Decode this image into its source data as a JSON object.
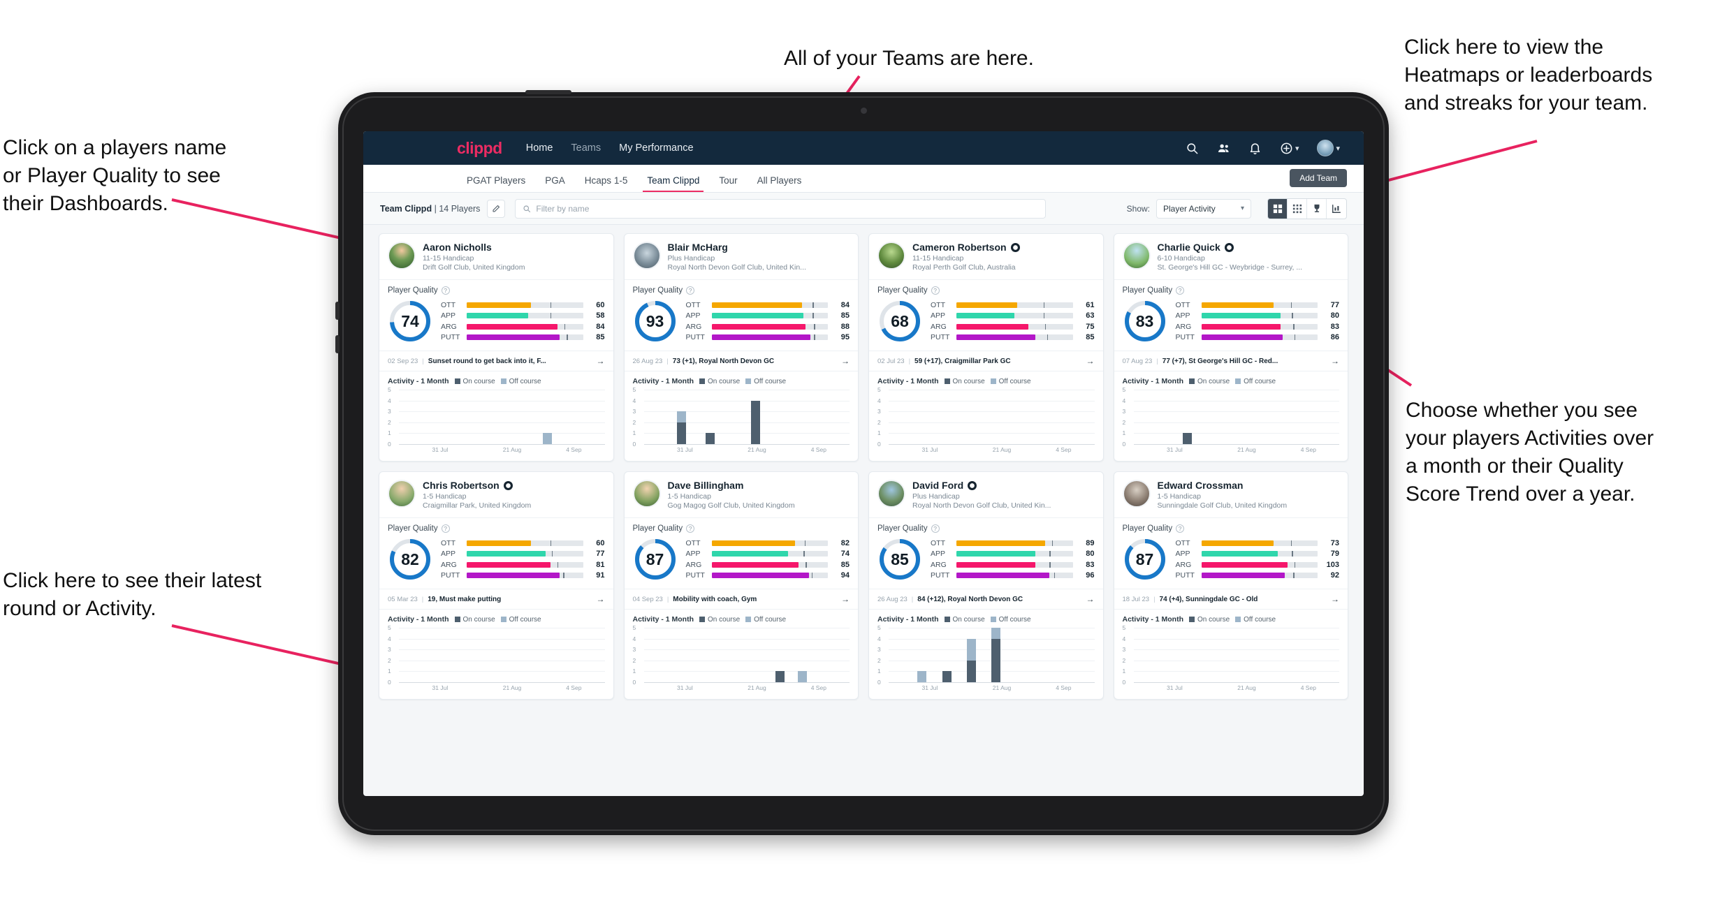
{
  "annotations": [
    {
      "id": "teams",
      "text": "All of your Teams are here."
    },
    {
      "id": "heatmaps",
      "text": "Click here to view the\nHeatmaps or leaderboards\nand streaks for your team."
    },
    {
      "id": "players",
      "text": "Click on a players name\nor Player Quality to see\ntheir Dashboards."
    },
    {
      "id": "activity",
      "text": "Choose whether you see\nyour players Activities over\na month or their Quality\nScore Trend over a year."
    },
    {
      "id": "latest",
      "text": "Click here to see their latest\nround or Activity."
    }
  ],
  "app": {
    "brand": "clippd",
    "nav": [
      {
        "label": "Home",
        "active": true
      },
      {
        "label": "Teams",
        "active": false
      },
      {
        "label": "My Performance",
        "active": true
      }
    ],
    "nav_icons": [
      "search-icon",
      "people-icon",
      "bell-icon",
      "plus-circle-icon",
      "avatar"
    ],
    "tabs": [
      {
        "label": "PGAT Players",
        "active": false
      },
      {
        "label": "PGA",
        "active": false
      },
      {
        "label": "Hcaps 1-5",
        "active": false
      },
      {
        "label": "Team Clippd",
        "active": true
      },
      {
        "label": "Tour",
        "active": false
      },
      {
        "label": "All Players",
        "active": false
      }
    ],
    "add_team_label": "Add Team",
    "toolbar": {
      "team_name": "Team Clippd",
      "separator": "|",
      "player_count": "14 Players",
      "search_placeholder": "Filter by name",
      "show_label": "Show:",
      "show_value": "Player Activity",
      "view_modes": [
        "split-view-icon",
        "grid-view-icon",
        "trophy-icon",
        "chart-icon"
      ],
      "active_view": 0
    },
    "colors": {
      "brand": "#ec2c63",
      "navbar": "#13293d",
      "ring": "#1878c8",
      "ott": "#f5a700",
      "app": "#2fd6ab",
      "arg": "#f5176b",
      "putt": "#b317c8",
      "on_course": "#4e5f6e",
      "off_course": "#9db5c9",
      "annotation_arrow": "#e8225f"
    }
  },
  "cards": [
    {
      "name": "Aaron Nicholls",
      "verified": false,
      "handicap": "11-15 Handicap",
      "club": "Drift Golf Club, United Kingdom",
      "pq_label": "Player Quality",
      "quality": 74,
      "metrics": [
        {
          "label": "OTT",
          "value": 60,
          "fill": 55,
          "tick": 72,
          "color": "#f5a700"
        },
        {
          "label": "APP",
          "value": 58,
          "fill": 53,
          "tick": 72,
          "color": "#2fd6ab"
        },
        {
          "label": "ARG",
          "value": 84,
          "fill": 78,
          "tick": 84,
          "color": "#f5176b"
        },
        {
          "label": "PUTT",
          "value": 85,
          "fill": 80,
          "tick": 86,
          "color": "#b317c8"
        }
      ],
      "round_date": "02 Sep 23",
      "round_text": "Sunset round to get back into it, F...",
      "activity": {
        "title": "Activity - 1 Month",
        "legend": [
          "On course",
          "Off course"
        ],
        "ymax": 5,
        "yticks": [
          5,
          4,
          3,
          2,
          1,
          0
        ],
        "xlabels": [
          "31 Jul",
          "21 Aug",
          "4 Sep"
        ],
        "bars": [
          {
            "pos": 0.7,
            "on": 0,
            "off": 1
          }
        ]
      }
    },
    {
      "name": "Blair McHarg",
      "verified": false,
      "handicap": "Plus Handicap",
      "club": "Royal North Devon Golf Club, United Kin...",
      "pq_label": "Player Quality",
      "quality": 93,
      "metrics": [
        {
          "label": "OTT",
          "value": 84,
          "fill": 78,
          "tick": 87,
          "color": "#f5a700"
        },
        {
          "label": "APP",
          "value": 85,
          "fill": 79,
          "tick": 87,
          "color": "#2fd6ab"
        },
        {
          "label": "ARG",
          "value": 88,
          "fill": 81,
          "tick": 88,
          "color": "#f5176b"
        },
        {
          "label": "PUTT",
          "value": 95,
          "fill": 85,
          "tick": 88,
          "color": "#b317c8"
        }
      ],
      "round_date": "26 Aug 23",
      "round_text": "73 (+1), Royal North Devon GC",
      "activity": {
        "title": "Activity - 1 Month",
        "legend": [
          "On course",
          "Off course"
        ],
        "ymax": 5,
        "yticks": [
          5,
          4,
          3,
          2,
          1,
          0
        ],
        "xlabels": [
          "31 Jul",
          "21 Aug",
          "4 Sep"
        ],
        "bars": [
          {
            "pos": 0.16,
            "on": 2,
            "off": 1
          },
          {
            "pos": 0.3,
            "on": 1,
            "off": 0
          },
          {
            "pos": 0.52,
            "on": 4,
            "off": 0
          }
        ]
      }
    },
    {
      "name": "Cameron Robertson",
      "verified": true,
      "handicap": "11-15 Handicap",
      "club": "Royal Perth Golf Club, Australia",
      "pq_label": "Player Quality",
      "quality": 68,
      "metrics": [
        {
          "label": "OTT",
          "value": 61,
          "fill": 52,
          "tick": 75,
          "color": "#f5a700"
        },
        {
          "label": "APP",
          "value": 63,
          "fill": 50,
          "tick": 75,
          "color": "#2fd6ab"
        },
        {
          "label": "ARG",
          "value": 75,
          "fill": 62,
          "tick": 76,
          "color": "#f5176b"
        },
        {
          "label": "PUTT",
          "value": 85,
          "fill": 68,
          "tick": 78,
          "color": "#b317c8"
        }
      ],
      "round_date": "02 Jul 23",
      "round_text": "59 (+17), Craigmillar Park GC",
      "activity": {
        "title": "Activity - 1 Month",
        "legend": [
          "On course",
          "Off course"
        ],
        "ymax": 5,
        "yticks": [
          5,
          4,
          3,
          2,
          1,
          0
        ],
        "xlabels": [
          "31 Jul",
          "21 Aug",
          "4 Sep"
        ],
        "bars": []
      }
    },
    {
      "name": "Charlie Quick",
      "verified": true,
      "handicap": "6-10 Handicap",
      "club": "St. George's Hill GC - Weybridge - Surrey, ...",
      "pq_label": "Player Quality",
      "quality": 83,
      "metrics": [
        {
          "label": "OTT",
          "value": 77,
          "fill": 62,
          "tick": 77,
          "color": "#f5a700"
        },
        {
          "label": "APP",
          "value": 80,
          "fill": 68,
          "tick": 78,
          "color": "#2fd6ab"
        },
        {
          "label": "ARG",
          "value": 83,
          "fill": 68,
          "tick": 79,
          "color": "#f5176b"
        },
        {
          "label": "PUTT",
          "value": 86,
          "fill": 70,
          "tick": 80,
          "color": "#b317c8"
        }
      ],
      "round_date": "07 Aug 23",
      "round_text": "77 (+7), St George's Hill GC - Red...",
      "activity": {
        "title": "Activity - 1 Month",
        "legend": [
          "On course",
          "Off course"
        ],
        "ymax": 5,
        "yticks": [
          5,
          4,
          3,
          2,
          1,
          0
        ],
        "xlabels": [
          "31 Jul",
          "21 Aug",
          "4 Sep"
        ],
        "bars": [
          {
            "pos": 0.24,
            "on": 1,
            "off": 0
          }
        ]
      }
    },
    {
      "name": "Chris Robertson",
      "verified": true,
      "handicap": "1-5 Handicap",
      "club": "Craigmillar Park, United Kingdom",
      "pq_label": "Player Quality",
      "quality": 82,
      "metrics": [
        {
          "label": "OTT",
          "value": 60,
          "fill": 55,
          "tick": 72,
          "color": "#f5a700"
        },
        {
          "label": "APP",
          "value": 77,
          "fill": 68,
          "tick": 73,
          "color": "#2fd6ab"
        },
        {
          "label": "ARG",
          "value": 81,
          "fill": 72,
          "tick": 78,
          "color": "#f5176b"
        },
        {
          "label": "PUTT",
          "value": 91,
          "fill": 80,
          "tick": 83,
          "color": "#b317c8"
        }
      ],
      "round_date": "05 Mar 23",
      "round_text": "19, Must make putting",
      "activity": {
        "title": "Activity - 1 Month",
        "legend": [
          "On course",
          "Off course"
        ],
        "ymax": 5,
        "yticks": [
          5,
          4,
          3,
          2,
          1,
          0
        ],
        "xlabels": [
          "31 Jul",
          "21 Aug",
          "4 Sep"
        ],
        "bars": []
      }
    },
    {
      "name": "Dave Billingham",
      "verified": false,
      "handicap": "1-5 Handicap",
      "club": "Gog Magog Golf Club, United Kingdom",
      "pq_label": "Player Quality",
      "quality": 87,
      "metrics": [
        {
          "label": "OTT",
          "value": 82,
          "fill": 72,
          "tick": 80,
          "color": "#f5a700"
        },
        {
          "label": "APP",
          "value": 74,
          "fill": 66,
          "tick": 79,
          "color": "#2fd6ab"
        },
        {
          "label": "ARG",
          "value": 85,
          "fill": 75,
          "tick": 81,
          "color": "#f5176b"
        },
        {
          "label": "PUTT",
          "value": 94,
          "fill": 84,
          "tick": 86,
          "color": "#b317c8"
        }
      ],
      "round_date": "04 Sep 23",
      "round_text": "Mobility with coach, Gym",
      "activity": {
        "title": "Activity - 1 Month",
        "legend": [
          "On course",
          "Off course"
        ],
        "ymax": 5,
        "yticks": [
          5,
          4,
          3,
          2,
          1,
          0
        ],
        "xlabels": [
          "31 Jul",
          "21 Aug",
          "4 Sep"
        ],
        "bars": [
          {
            "pos": 0.64,
            "on": 1,
            "off": 0
          },
          {
            "pos": 0.75,
            "on": 0,
            "off": 1
          }
        ]
      }
    },
    {
      "name": "David Ford",
      "verified": true,
      "handicap": "Plus Handicap",
      "club": "Royal North Devon Golf Club, United Kin...",
      "pq_label": "Player Quality",
      "quality": 85,
      "metrics": [
        {
          "label": "OTT",
          "value": 89,
          "fill": 76,
          "tick": 82,
          "color": "#f5a700"
        },
        {
          "label": "APP",
          "value": 80,
          "fill": 68,
          "tick": 80,
          "color": "#2fd6ab"
        },
        {
          "label": "ARG",
          "value": 83,
          "fill": 68,
          "tick": 80,
          "color": "#f5176b"
        },
        {
          "label": "PUTT",
          "value": 96,
          "fill": 80,
          "tick": 84,
          "color": "#b317c8"
        }
      ],
      "round_date": "26 Aug 23",
      "round_text": "84 (+12), Royal North Devon GC",
      "activity": {
        "title": "Activity - 1 Month",
        "legend": [
          "On course",
          "Off course"
        ],
        "ymax": 5,
        "yticks": [
          5,
          4,
          3,
          2,
          1,
          0
        ],
        "xlabels": [
          "31 Jul",
          "21 Aug",
          "4 Sep"
        ],
        "bars": [
          {
            "pos": 0.14,
            "on": 0,
            "off": 1
          },
          {
            "pos": 0.26,
            "on": 1,
            "off": 0
          },
          {
            "pos": 0.38,
            "on": 2,
            "off": 2
          },
          {
            "pos": 0.5,
            "on": 4,
            "off": 1
          }
        ]
      }
    },
    {
      "name": "Edward Crossman",
      "verified": false,
      "handicap": "1-5 Handicap",
      "club": "Sunningdale Golf Club, United Kingdom",
      "pq_label": "Player Quality",
      "quality": 87,
      "metrics": [
        {
          "label": "OTT",
          "value": 73,
          "fill": 62,
          "tick": 77,
          "color": "#f5a700"
        },
        {
          "label": "APP",
          "value": 79,
          "fill": 66,
          "tick": 78,
          "color": "#2fd6ab"
        },
        {
          "label": "ARG",
          "value": 103,
          "fill": 74,
          "tick": 80,
          "color": "#f5176b"
        },
        {
          "label": "PUTT",
          "value": 92,
          "fill": 72,
          "tick": 79,
          "color": "#b317c8"
        }
      ],
      "round_date": "18 Jul 23",
      "round_text": "74 (+4), Sunningdale GC - Old",
      "activity": {
        "title": "Activity - 1 Month",
        "legend": [
          "On course",
          "Off course"
        ],
        "ymax": 5,
        "yticks": [
          5,
          4,
          3,
          2,
          1,
          0
        ],
        "xlabels": [
          "31 Jul",
          "21 Aug",
          "4 Sep"
        ],
        "bars": []
      }
    }
  ]
}
